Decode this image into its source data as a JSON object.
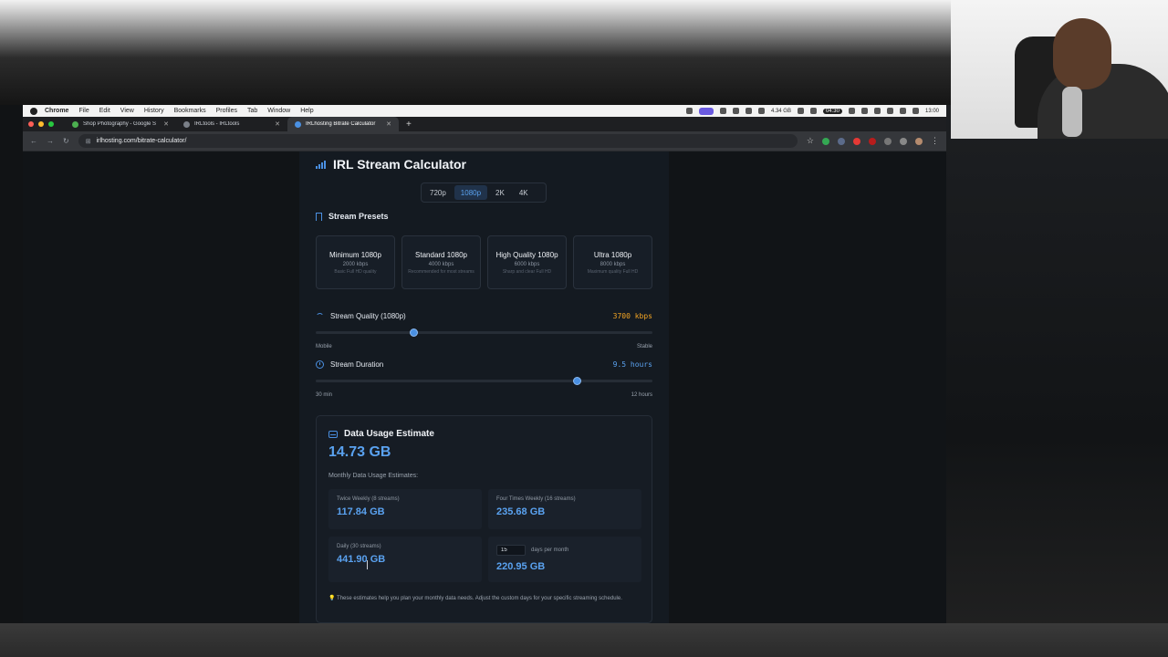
{
  "macos_menu": {
    "app": "Chrome",
    "items": [
      "File",
      "Edit",
      "View",
      "History",
      "Bookmarks",
      "Profiles",
      "Tab",
      "Window",
      "Help"
    ],
    "status": {
      "storage": "4.34 GB",
      "timer": "04:30",
      "time": "13:00"
    }
  },
  "browser": {
    "tabs": [
      {
        "title": "Shop Photography - Google S",
        "active": false
      },
      {
        "title": "IRLtools - IRLtools",
        "active": false
      },
      {
        "title": "IRLhosting Bitrate Calculator",
        "active": true
      }
    ],
    "url": "irlhosting.com/bitrate-calculator/"
  },
  "calculator": {
    "title": "IRL Stream Calculator",
    "resolutions": [
      "720p",
      "1080p",
      "2K",
      "4K"
    ],
    "selected_resolution": "1080p",
    "presets_title": "Stream Presets",
    "presets": [
      {
        "name": "Minimum 1080p",
        "kbps": "2000 kbps",
        "desc": "Basic Full HD quality"
      },
      {
        "name": "Standard 1080p",
        "kbps": "4000 kbps",
        "desc": "Recommended for most streams"
      },
      {
        "name": "High Quality 1080p",
        "kbps": "6000 kbps",
        "desc": "Sharp and clear Full HD"
      },
      {
        "name": "Ultra 1080p",
        "kbps": "8000 kbps",
        "desc": "Maximum quality Full HD"
      }
    ],
    "quality": {
      "label": "Stream Quality (1080p)",
      "value": "3700 kbps",
      "min_label": "Mobile",
      "max_label": "Stable",
      "fraction": 0.29
    },
    "duration": {
      "label": "Stream Duration",
      "value": "9.5 hours",
      "min_label": "30 min",
      "max_label": "12 hours",
      "fraction": 0.775
    },
    "usage": {
      "title": "Data Usage Estimate",
      "total": "14.73 GB",
      "monthly_title": "Monthly Data Usage Estimates:",
      "twice_weekly": {
        "label": "Twice Weekly (8 streams)",
        "value": "117.84 GB"
      },
      "four_weekly": {
        "label": "Four Times Weekly (16 streams)",
        "value": "235.68 GB"
      },
      "daily": {
        "label": "Daily (30 streams)",
        "value": "441.90 GB"
      },
      "custom": {
        "days": "15",
        "label": "days per month",
        "value": "220.95 GB"
      },
      "tip": "💡 These estimates help you plan your monthly data needs. Adjust the custom days for your specific streaming schedule."
    }
  },
  "colors": {
    "accent": "#4a90e2",
    "value_orange": "#f5a623",
    "page_bg": "#111417",
    "card_bg": "#141a21"
  }
}
